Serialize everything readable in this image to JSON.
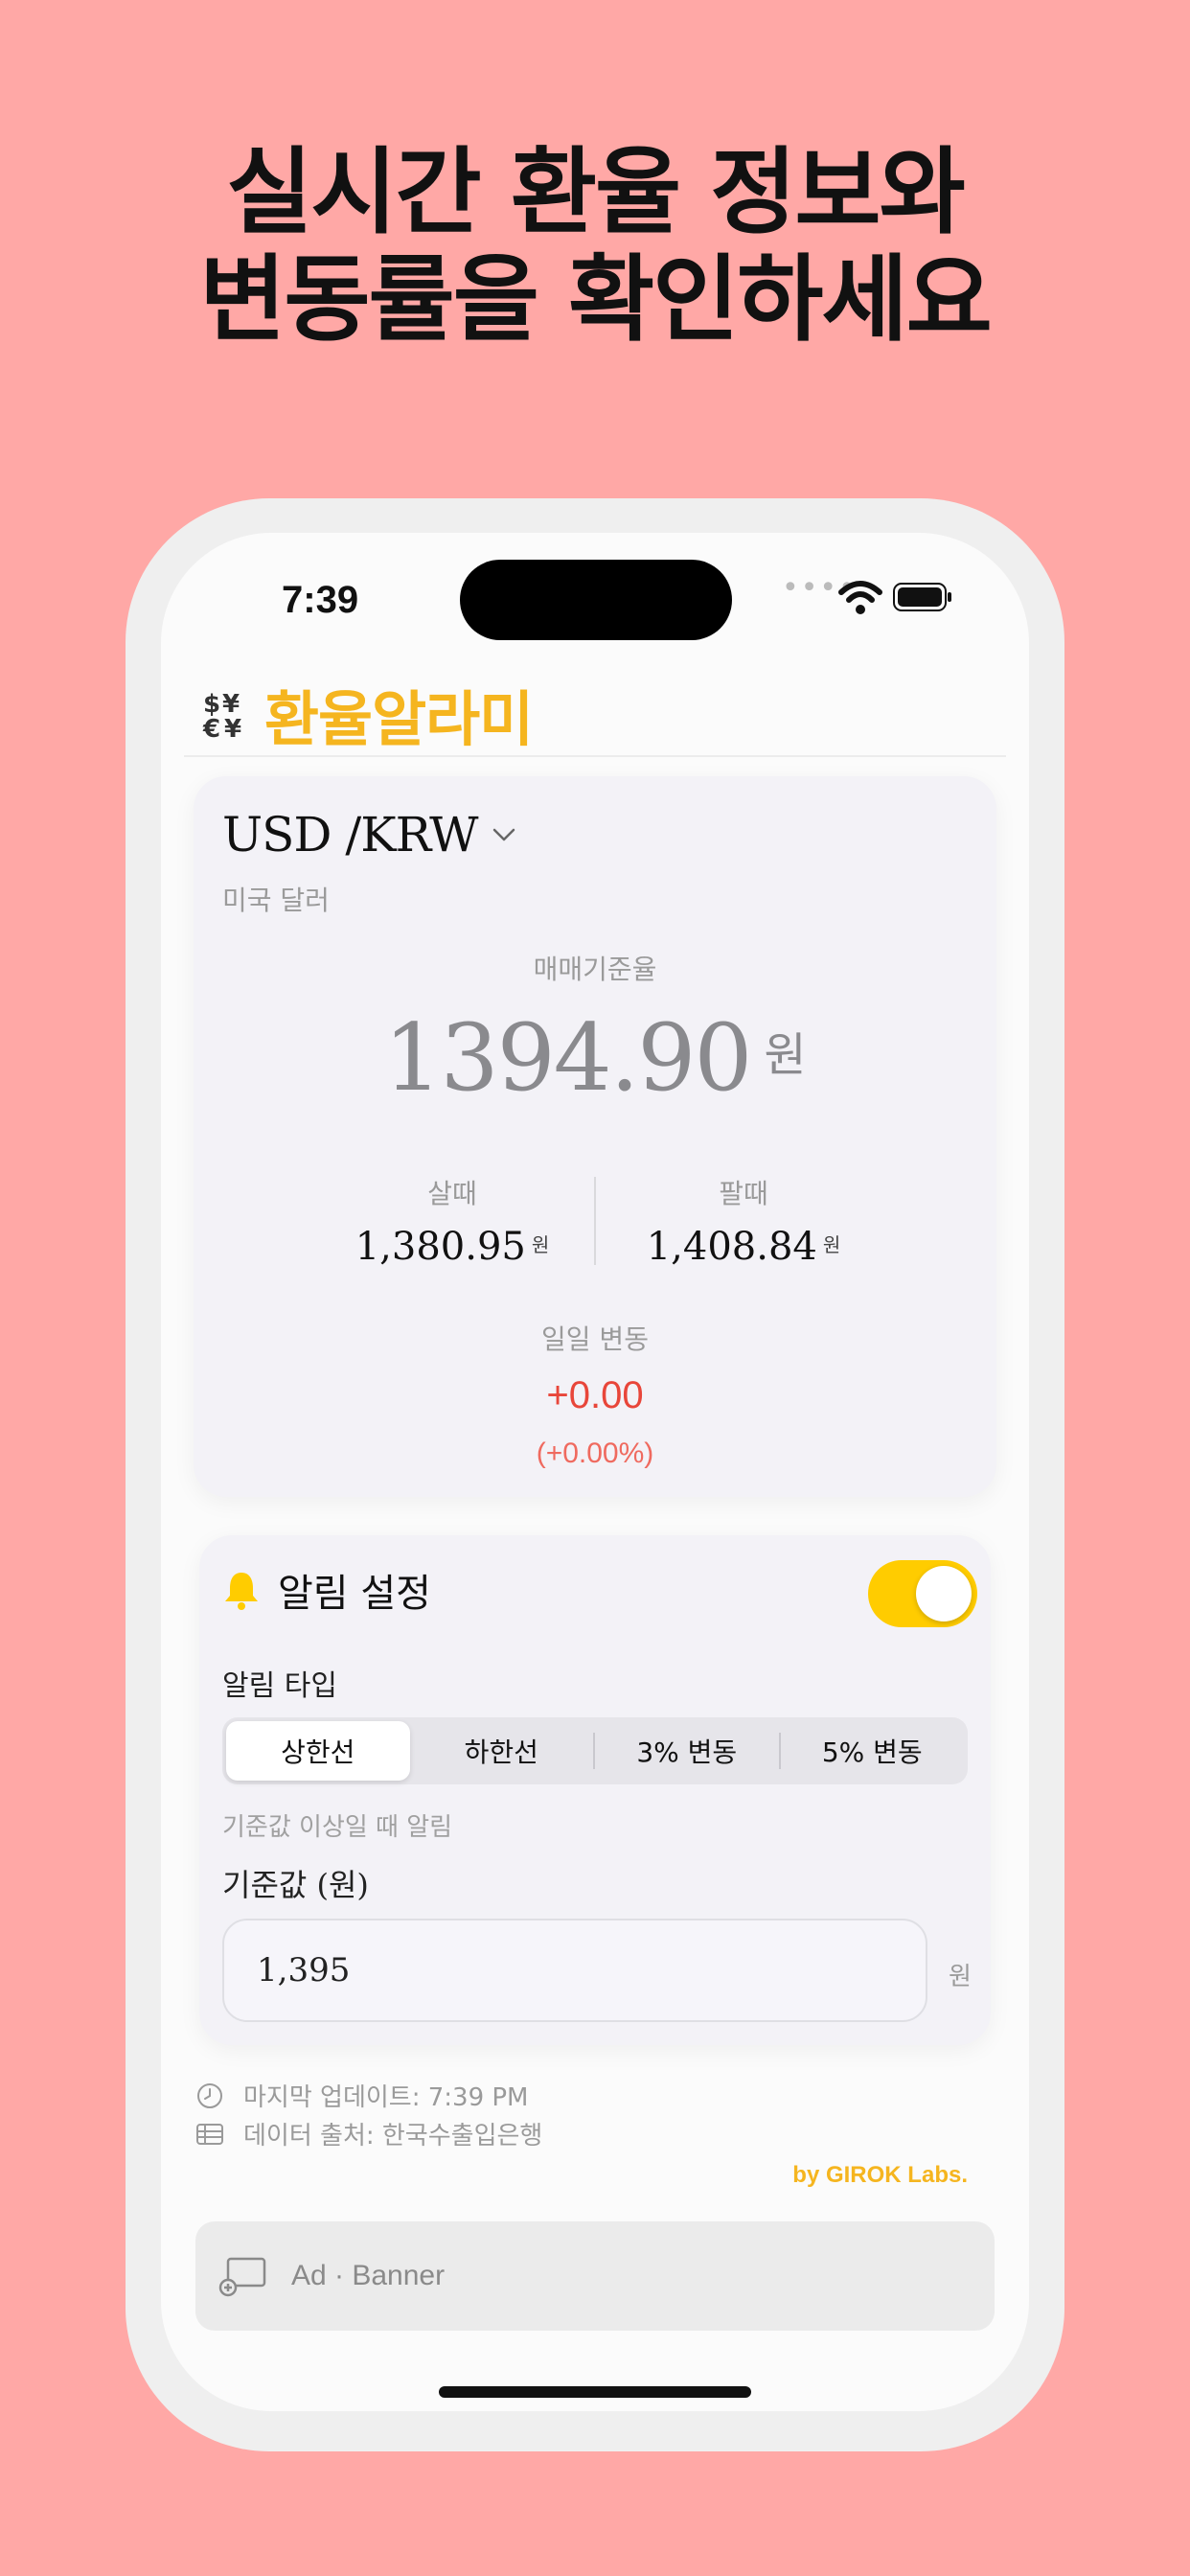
{
  "headline": {
    "line1": "실시간 환율 정보와",
    "line2": "변동률을 확인하세요"
  },
  "status_bar": {
    "time": "7:39",
    "signal": "••••"
  },
  "app": {
    "title": "환율알라미"
  },
  "rate_card": {
    "pair": "USD /KRW",
    "currency_name": "미국 달러",
    "basis_label": "매매기준율",
    "basis_value": "1394.90",
    "basis_unit": "원",
    "buy_label": "살때",
    "buy_value": "1,380.95",
    "buy_unit": "원",
    "sell_label": "팔때",
    "sell_value": "1,408.84",
    "sell_unit": "원",
    "daily_label": "일일 변동",
    "daily_change": "+0.00",
    "daily_change_pct": "(+0.00%)",
    "change_color": "#e8463a"
  },
  "alert_card": {
    "title": "알림 설정",
    "enabled": true,
    "type_label": "알림 타입",
    "segments": [
      "상한선",
      "하한선",
      "3% 변동",
      "5% 변동"
    ],
    "selected_segment": "상한선",
    "type_hint": "기준값 이상일 때 알림",
    "reference_label": "기준값 (원)",
    "reference_value": "1,395",
    "reference_unit": "원"
  },
  "footer": {
    "last_update": "마지막 업데이트: 7:39 PM",
    "data_source": "데이터 출처: 한국수출입은행",
    "credit": "by GIROK Labs.",
    "ad_text": "Ad · Banner"
  },
  "colors": {
    "background": "#ffa8a6",
    "accent": "#f5b51f",
    "toggle_on": "#ffcc00"
  }
}
